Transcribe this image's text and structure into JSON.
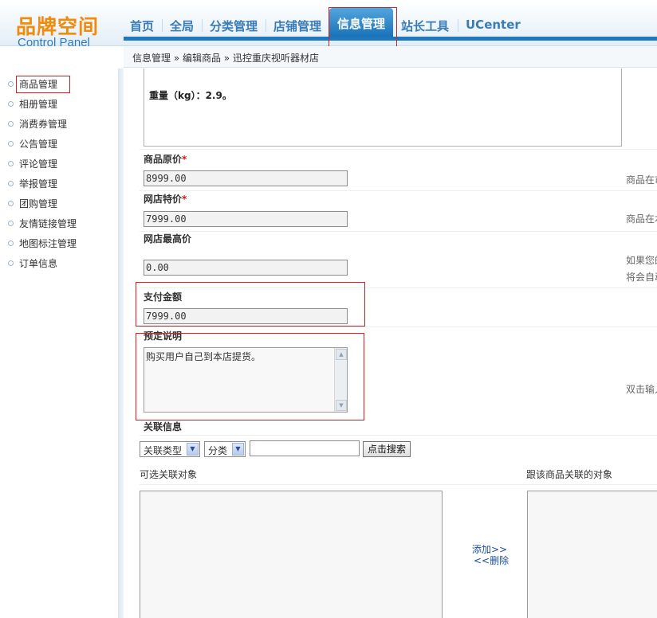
{
  "logo": {
    "title": "品牌空间",
    "subtitle": "Control Panel"
  },
  "nav": {
    "items": [
      "首页",
      "全局",
      "分类管理",
      "店铺管理",
      "信息管理",
      "站长工具",
      "UCenter"
    ],
    "active": "信息管理"
  },
  "breadcrumb": "信息管理 » 编辑商品 » 迅控重庆视听器材店",
  "sidebar": {
    "items": [
      "商品管理",
      "相册管理",
      "消费券管理",
      "公告管理",
      "评论管理",
      "举报管理",
      "团购管理",
      "友情链接管理",
      "地图标注管理",
      "订单信息"
    ]
  },
  "form": {
    "description_text": "重量（kg）：2.9。",
    "original_price": {
      "label": "商品原价",
      "required": "*",
      "value": "8999.00",
      "hint": "商品在市"
    },
    "special_price": {
      "label": "网店特价",
      "required": "*",
      "value": "7999.00",
      "hint": "商品在本"
    },
    "max_price": {
      "label": "网店最高价",
      "value": "0.00",
      "hint_line1": "如果您的",
      "hint_line2": "将会自动"
    },
    "payment_amount": {
      "label": "支付金额",
      "value": "7999.00"
    },
    "preorder_note": {
      "label": "预定说明",
      "value": "购买用户自己到本店提货。",
      "hint": "双击输入"
    },
    "related": {
      "label": "关联信息",
      "type_select": "关联类型",
      "category_select": "分类",
      "search_button": "点击搜索",
      "available_label": "可选关联对象",
      "linked_label": "跟该商品关联的对象",
      "add_link": "添加>>",
      "remove_link": "<<删除"
    }
  },
  "colors": {
    "accent": "#1d78bd",
    "logo": "#f28b0c",
    "highlight": "#d42020"
  }
}
